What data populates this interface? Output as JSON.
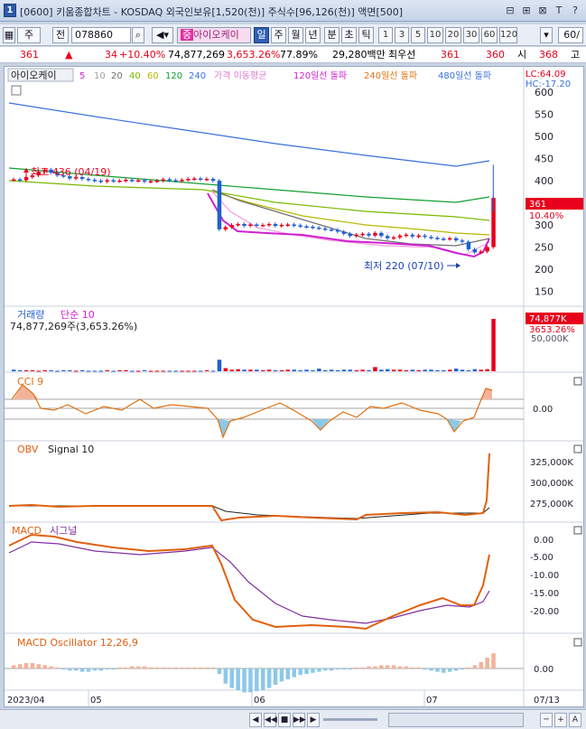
{
  "window": {
    "number": "1",
    "title": "[0600] 키움종합차트 - KOSDAQ 외국인보유[1,520(천)] 주식수[96,126(천)] 액면[500]",
    "buttons": [
      "⊟",
      "⊞",
      "⊠",
      "T",
      "?"
    ]
  },
  "toolbar": {
    "market": "주",
    "prev_label": "전",
    "code": "078860",
    "name": "아이오케이",
    "name_prefix": "중",
    "periods": [
      "일",
      "주",
      "월",
      "년",
      "분",
      "초",
      "틱"
    ],
    "active_period": "일",
    "intervals": [
      "1",
      "3",
      "5",
      "10",
      "20",
      "30",
      "60",
      "120"
    ],
    "count": "60",
    "count_arrow": "/"
  },
  "infobar": {
    "price": "361",
    "change": "34",
    "change_pct": "+10.40%",
    "volume": "74,877,269",
    "volume_pct": "3,653.26%",
    "ratio": "77.89%",
    "amount": "29,280백만",
    "best_label": "최우선",
    "best_sell": "361",
    "best_buy": "360",
    "open_label": "시",
    "open": "368",
    "high_label": "고"
  },
  "legend": {
    "name": "아이오케이",
    "ma": [
      "5",
      "10",
      "20",
      "40",
      "60",
      "120",
      "240"
    ],
    "ma_label": "가격 이동평균",
    "break120": "120일선 돌파",
    "break240": "240일선 돌파",
    "break480": "480일선 돌파",
    "lc": "LC:64.09",
    "hc": "HC:-17.20"
  },
  "colors": {
    "up": "#e8001c",
    "down": "#1f5fd6",
    "ma5": "#d020d0",
    "ma10": "#a0a0a0",
    "ma20": "#707070",
    "ma40": "#7ab800",
    "ma60": "#b8b800",
    "ma120": "#10a030",
    "ma240": "#3a6fdc",
    "ma480": "#3a6fdc",
    "cci": "#e07010",
    "obv": "#e06010",
    "macd": "#e06010",
    "signal": "#8030a0"
  },
  "price_panel": {
    "high_note": "최고 436 (04/19)",
    "low_note": "최저 220 (07/10)",
    "axis": [
      "600",
      "550",
      "500",
      "450",
      "400",
      "350",
      "300",
      "250",
      "200",
      "150"
    ],
    "current": "361",
    "current_pct": "10.40%"
  },
  "volume_panel": {
    "title": "거래량",
    "ma_label": "단순 10",
    "value": "74,877,269주(3,653.26%)",
    "last_label": "74,877K",
    "last_pct": "3653.26%",
    "axis": [
      "50,000K"
    ],
    "bars": [
      3,
      2,
      2,
      2,
      1,
      2,
      2,
      1,
      2,
      2,
      1,
      2,
      1,
      1,
      1,
      2,
      1,
      2,
      2,
      1,
      1,
      2,
      1,
      1,
      1,
      1,
      1,
      1,
      1,
      1,
      1,
      2,
      1,
      22,
      6,
      3,
      4,
      3,
      3,
      3,
      2,
      3,
      2,
      2,
      3,
      3,
      2,
      3,
      2,
      5,
      2,
      3,
      2,
      3,
      3,
      2,
      3,
      2,
      8,
      3,
      4,
      3,
      3,
      2,
      3,
      2,
      3,
      3,
      2,
      2,
      3,
      5,
      3,
      2,
      4,
      3,
      4,
      100
    ]
  },
  "cci_panel": {
    "title": "CCI 9",
    "axis": [
      "0.00"
    ]
  },
  "obv_panel": {
    "title": "OBV",
    "signal": "Signal 10",
    "axis": [
      "325,000K",
      "300,000K",
      "275,000K"
    ]
  },
  "macd_panel": {
    "title": "MACD",
    "signal": "시그널",
    "axis": [
      "0.00",
      "-5.00",
      "-10.00",
      "-15.00",
      "-20.00"
    ]
  },
  "osc_panel": {
    "title": "MACD Oscillator 12,26,9",
    "axis": [
      "0.00"
    ]
  },
  "xaxis": {
    "labels": [
      "2023/04",
      "05",
      "06",
      "07"
    ],
    "right_label": "07/13"
  },
  "bottom": {
    "buttons": [
      "◀",
      "◀◀",
      "■",
      "▶▶",
      "▶",
      "─",
      "+",
      "A"
    ]
  },
  "chart_data": {
    "type": "candlestick",
    "close": [
      403,
      401,
      408,
      412,
      420,
      425,
      418,
      412,
      410,
      405,
      408,
      404,
      402,
      400,
      398,
      401,
      399,
      400,
      402,
      400,
      401,
      398,
      399,
      400,
      403,
      401,
      400,
      402,
      404,
      405,
      403,
      404,
      400,
      290,
      295,
      300,
      302,
      298,
      301,
      299,
      300,
      302,
      298,
      300,
      301,
      299,
      297,
      296,
      294,
      292,
      290,
      289,
      285,
      280,
      275,
      278,
      280,
      276,
      282,
      275,
      270,
      272,
      276,
      278,
      274,
      276,
      273,
      271,
      269,
      268,
      270,
      265,
      262,
      245,
      238,
      240,
      250,
      361
    ],
    "ma480_start": 580,
    "ma480_end": 458
  }
}
